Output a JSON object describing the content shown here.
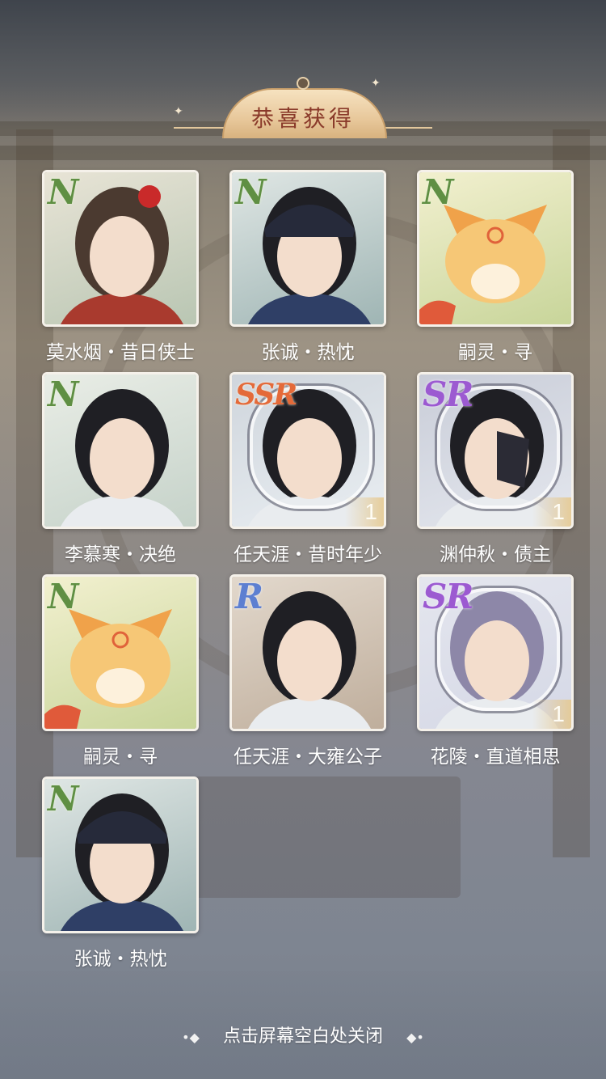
{
  "header": {
    "title": "恭喜获得"
  },
  "cards": [
    {
      "rarity": "N",
      "name": "莫水烟・昔日侠士",
      "count": "",
      "icon": "lady-portrait",
      "bg": [
        "#e8e4d6",
        "#b9c6b3"
      ]
    },
    {
      "rarity": "N",
      "name": "张诚・热忱",
      "count": "",
      "icon": "official-portrait",
      "bg": [
        "#dfe6e4",
        "#9fb5b4"
      ]
    },
    {
      "rarity": "N",
      "name": "嗣灵・寻",
      "count": "",
      "icon": "fox-portrait",
      "bg": [
        "#f2f0cf",
        "#c8d59a"
      ]
    },
    {
      "rarity": "N",
      "name": "李慕寒・决绝",
      "count": "",
      "icon": "swordsman-portrait",
      "bg": [
        "#e9ede6",
        "#c5d2c9"
      ]
    },
    {
      "rarity": "SSR",
      "name": "任天涯・昔时年少",
      "count": "1",
      "icon": "youth-portrait",
      "bg": [
        "#cfd5dc",
        "#e9eef2"
      ]
    },
    {
      "rarity": "SR",
      "name": "渊仲秋・债主",
      "count": "1",
      "icon": "masked-portrait",
      "bg": [
        "#c9cdd8",
        "#e4e7ee"
      ]
    },
    {
      "rarity": "N",
      "name": "嗣灵・寻",
      "count": "",
      "icon": "fox-portrait",
      "bg": [
        "#f2f0cf",
        "#c8d59a"
      ]
    },
    {
      "rarity": "R",
      "name": "任天涯・大雍公子",
      "count": "",
      "icon": "noble-portrait",
      "bg": [
        "#e2d8cc",
        "#bfae9c"
      ]
    },
    {
      "rarity": "SR",
      "name": "花陵・直道相思",
      "count": "1",
      "icon": "silver-hair-portrait",
      "bg": [
        "#e4e6ee",
        "#d5d8e6"
      ]
    },
    {
      "rarity": "N",
      "name": "张诚・热忱",
      "count": "",
      "icon": "official-portrait",
      "bg": [
        "#dfe6e4",
        "#9fb5b4"
      ]
    }
  ],
  "footer": {
    "hint": "点击屏幕空白处关闭"
  }
}
